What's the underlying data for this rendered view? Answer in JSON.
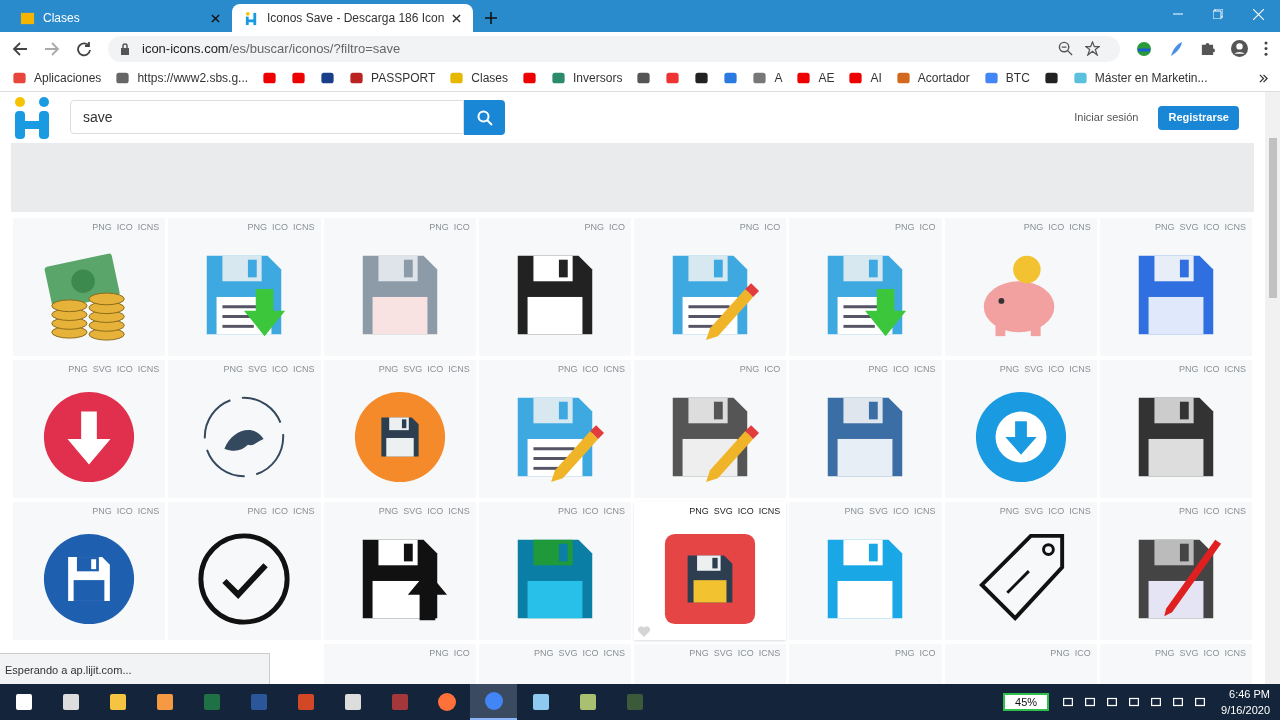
{
  "browser": {
    "tabs": [
      {
        "title": "Clases",
        "selected": false
      },
      {
        "title": "Iconos Save - Descarga 186 Icon",
        "selected": true
      }
    ],
    "url_host": "icon-icons.com",
    "url_path": "/es/buscar/iconos/?filtro=save",
    "bookmarks": [
      {
        "kind": "link",
        "label": "Aplicaciones"
      },
      {
        "kind": "link",
        "label": "https://www2.sbs.g..."
      },
      {
        "kind": "icon"
      },
      {
        "kind": "icon"
      },
      {
        "kind": "icon"
      },
      {
        "kind": "link",
        "label": "PASSPORT"
      },
      {
        "kind": "link",
        "label": "Clases"
      },
      {
        "kind": "icon"
      },
      {
        "kind": "link",
        "label": "Inversors"
      },
      {
        "kind": "icon"
      },
      {
        "kind": "icon"
      },
      {
        "kind": "icon"
      },
      {
        "kind": "icon"
      },
      {
        "kind": "link",
        "label": "A"
      },
      {
        "kind": "link",
        "label": "AE"
      },
      {
        "kind": "link",
        "label": "AI"
      },
      {
        "kind": "link",
        "label": "Acortador"
      },
      {
        "kind": "link",
        "label": "BTC"
      },
      {
        "kind": "icon"
      },
      {
        "kind": "link",
        "label": "Máster en Marketin..."
      }
    ]
  },
  "header": {
    "search_value": "save",
    "login": "Iniciar sesión",
    "register": "Registrarse"
  },
  "rows": [
    [
      {
        "formats": [
          "PNG",
          "ICO",
          "ICNS"
        ],
        "hovered": false
      },
      {
        "formats": [
          "PNG",
          "ICO",
          "ICNS"
        ],
        "hovered": false
      },
      {
        "formats": [
          "PNG",
          "ICO"
        ],
        "hovered": false
      },
      {
        "formats": [
          "PNG",
          "ICO"
        ],
        "hovered": false
      },
      {
        "formats": [
          "PNG",
          "ICO"
        ],
        "hovered": false
      },
      {
        "formats": [
          "PNG",
          "ICO"
        ],
        "hovered": false
      },
      {
        "formats": [
          "PNG",
          "ICO",
          "ICNS"
        ],
        "hovered": false
      },
      {
        "formats": [
          "PNG",
          "SVG",
          "ICO",
          "ICNS"
        ],
        "hovered": false
      }
    ],
    [
      {
        "formats": [
          "PNG",
          "SVG",
          "ICO",
          "ICNS"
        ],
        "hovered": false
      },
      {
        "formats": [
          "PNG",
          "SVG",
          "ICO",
          "ICNS"
        ],
        "hovered": false
      },
      {
        "formats": [
          "PNG",
          "SVG",
          "ICO",
          "ICNS"
        ],
        "hovered": false
      },
      {
        "formats": [
          "PNG",
          "ICO",
          "ICNS"
        ],
        "hovered": false
      },
      {
        "formats": [
          "PNG",
          "ICO"
        ],
        "hovered": false
      },
      {
        "formats": [
          "PNG",
          "ICO",
          "ICNS"
        ],
        "hovered": false
      },
      {
        "formats": [
          "PNG",
          "SVG",
          "ICO",
          "ICNS"
        ],
        "hovered": false
      },
      {
        "formats": [
          "PNG",
          "ICO",
          "ICNS"
        ],
        "hovered": false
      }
    ],
    [
      {
        "formats": [
          "PNG",
          "ICO",
          "ICNS"
        ],
        "hovered": false
      },
      {
        "formats": [
          "PNG",
          "ICO",
          "ICNS"
        ],
        "hovered": false
      },
      {
        "formats": [
          "PNG",
          "SVG",
          "ICO",
          "ICNS"
        ],
        "hovered": false
      },
      {
        "formats": [
          "PNG",
          "ICO",
          "ICNS"
        ],
        "hovered": false
      },
      {
        "formats": [
          "PNG",
          "SVG",
          "ICO",
          "ICNS"
        ],
        "hovered": true
      },
      {
        "formats": [
          "PNG",
          "SVG",
          "ICO",
          "ICNS"
        ],
        "hovered": false
      },
      {
        "formats": [
          "PNG",
          "SVG",
          "ICO",
          "ICNS"
        ],
        "hovered": false
      },
      {
        "formats": [
          "PNG",
          "ICO",
          "ICNS"
        ],
        "hovered": false
      }
    ]
  ],
  "partial_row": [
    {
      "formats": [
        "PNG",
        "ICO"
      ]
    },
    {
      "formats": [
        "PNG",
        "SVG",
        "ICO",
        "ICNS"
      ]
    },
    {
      "formats": [
        "PNG",
        "SVG",
        "ICO",
        "ICNS"
      ]
    },
    {
      "formats": [
        "PNG",
        "ICO"
      ]
    },
    {
      "formats": [
        "PNG",
        "ICO"
      ]
    },
    {
      "formats": [
        "PNG",
        "SVG",
        "ICO",
        "ICNS"
      ]
    }
  ],
  "status": "Esperando a ap.lijit.com...",
  "taskbar": {
    "battery": "45%",
    "time": "6:46 PM",
    "date": "9/16/2020"
  }
}
